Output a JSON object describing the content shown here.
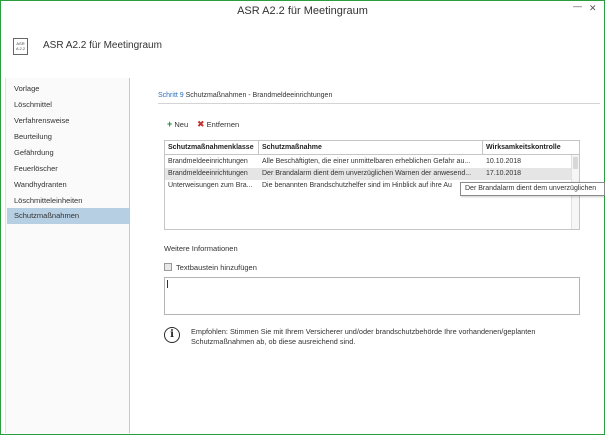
{
  "window": {
    "title": "ASR A2.2 für Meetingraum",
    "min_glyph": "—",
    "close_glyph": "✕"
  },
  "app": {
    "icon_line1": "ASR",
    "icon_line2": "A 2.2",
    "title": "ASR A2.2 für Meetingraum"
  },
  "sidebar": {
    "items": [
      {
        "label": "Vorlage"
      },
      {
        "label": "Löschmittel"
      },
      {
        "label": "Verfahrensweise"
      },
      {
        "label": "Beurteilung"
      },
      {
        "label": "Gefährdung"
      },
      {
        "label": "Feuerlöscher"
      },
      {
        "label": "Wandhydranten"
      },
      {
        "label": "Löschmitteleinheiten"
      },
      {
        "label": "Schutzmaßnahmen"
      }
    ],
    "active_index": 8
  },
  "step": {
    "number": "Schritt 9",
    "title": "Schutzmaßnahmen - Brandmeldeeinrichtungen"
  },
  "toolbar": {
    "new_icon": "+",
    "new_label": "Neu",
    "delete_icon": "✖",
    "delete_label": "Entfernen"
  },
  "table": {
    "headers": [
      "Schutzmaßnahmenklasse",
      "Schutzmaßnahme",
      "Wirksamkeitskontrolle"
    ],
    "rows": [
      [
        "Brandmeldeeinrichtungen",
        "Alle Beschäftigten, die einer unmittelbaren erheblichen Gefahr au...",
        "10.10.2018"
      ],
      [
        "Brandmeldeeinrichtungen",
        "Der Brandalarm dient dem unverzüglichen Warnen der anwesend...",
        "17.10.2018"
      ],
      [
        "Unterweisungen zum Bra...",
        "Die benannten Brandschutzhelfer sind im Hinblick auf ihre Au",
        ""
      ]
    ],
    "selected_row": 1,
    "tooltip": "Der Brandalarm dient dem unverzüglichen"
  },
  "details": {
    "section_label": "Weitere Informationen",
    "checkbox_label": "Textbaustein hinzufügen",
    "textarea_value": ""
  },
  "info": {
    "icon": "i",
    "text": "Empfohlen: Stimmen Sie mit Ihrem Versicherer und/oder brandschutzbehörde Ihre vorhandenen/geplanten Schutzmaßnahmen ab, ob diese ausreichend sind."
  }
}
